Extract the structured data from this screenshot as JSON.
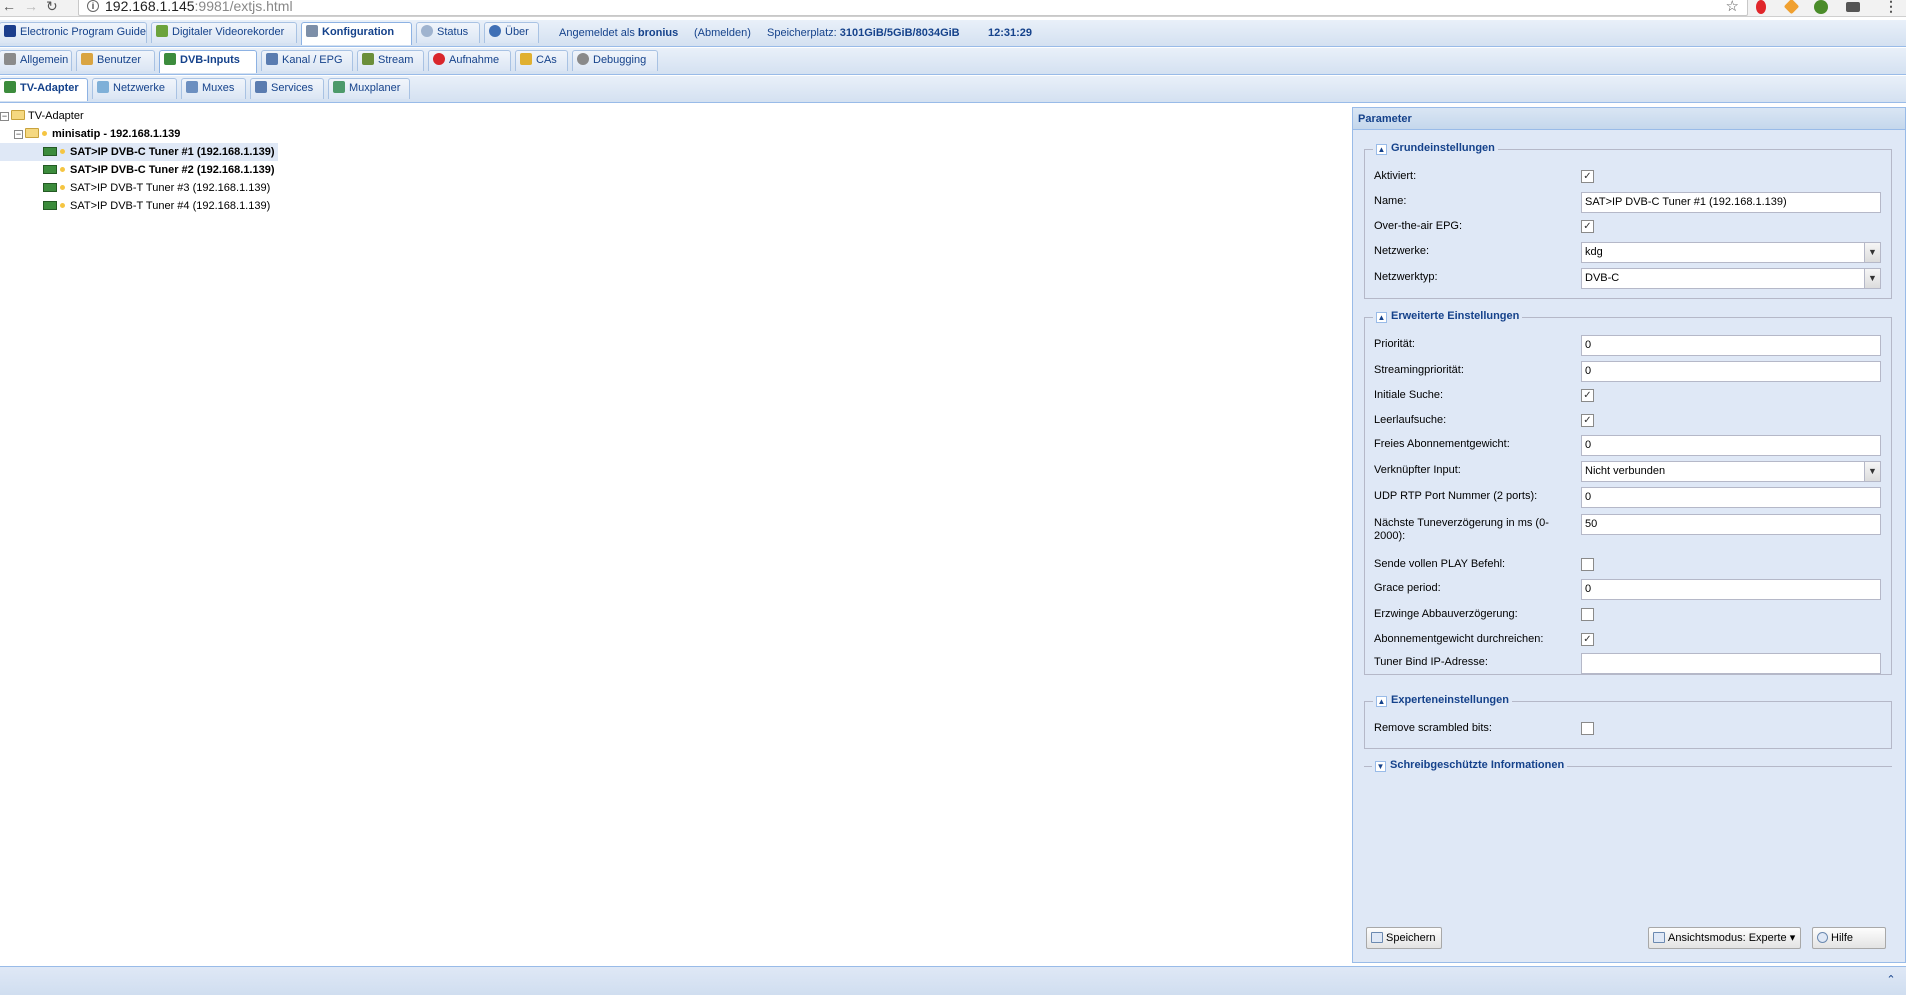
{
  "browser": {
    "url_host": "192.168.1.145",
    "url_rest": ":9981/extjs.html",
    "star_icon": "star-icon"
  },
  "top_tabs": [
    {
      "label": "Electronic Program Guide",
      "icon": "epg-icon",
      "active": false
    },
    {
      "label": "Digitaler Videorekorder",
      "icon": "dvr-icon",
      "active": false
    },
    {
      "label": "Konfiguration",
      "icon": "wrench-icon",
      "active": true
    },
    {
      "label": "Status",
      "icon": "eye-icon",
      "active": false
    },
    {
      "label": "Über",
      "icon": "info-icon",
      "active": false
    }
  ],
  "user_info": {
    "prefix": "Angemeldet als",
    "user": "bronius",
    "logout": "(Abmelden)",
    "storage_label": "Speicherplatz:",
    "storage_value": "3101GiB/5GiB/8034GiB",
    "time": "12:31:29"
  },
  "config_tabs": [
    {
      "label": "Allgemein",
      "active": false
    },
    {
      "label": "Benutzer",
      "active": false
    },
    {
      "label": "DVB-Inputs",
      "active": true
    },
    {
      "label": "Kanal / EPG",
      "active": false
    },
    {
      "label": "Stream",
      "active": false
    },
    {
      "label": "Aufnahme",
      "active": false
    },
    {
      "label": "CAs",
      "active": false
    },
    {
      "label": "Debugging",
      "active": false
    }
  ],
  "dvb_tabs": [
    {
      "label": "TV-Adapter",
      "active": true
    },
    {
      "label": "Netzwerke",
      "active": false
    },
    {
      "label": "Muxes",
      "active": false
    },
    {
      "label": "Services",
      "active": false
    },
    {
      "label": "Muxplaner",
      "active": false
    }
  ],
  "tree": {
    "root": "TV-Adapter",
    "device": "minisatip - 192.168.1.139",
    "tuners": [
      {
        "label": "SAT>IP DVB-C Tuner #1 (192.168.1.139)",
        "selected": true,
        "bold": true
      },
      {
        "label": "SAT>IP DVB-C Tuner #2 (192.168.1.139)",
        "selected": false,
        "bold": true
      },
      {
        "label": "SAT>IP DVB-T Tuner #3 (192.168.1.139)",
        "selected": false,
        "bold": false
      },
      {
        "label": "SAT>IP DVB-T Tuner #4 (192.168.1.139)",
        "selected": false,
        "bold": false
      }
    ]
  },
  "panel": {
    "title": "Parameter",
    "basic": {
      "legend": "Grundeinstellungen",
      "aktiviert": {
        "label": "Aktiviert:",
        "checked": true
      },
      "name": {
        "label": "Name:",
        "value": "SAT>IP DVB-C Tuner #1 (192.168.1.139)"
      },
      "epg": {
        "label": "Over-the-air EPG:",
        "checked": true
      },
      "netzwerke": {
        "label": "Netzwerke:",
        "value": "kdg"
      },
      "netzwerktyp": {
        "label": "Netzwerktyp:",
        "value": "DVB-C"
      }
    },
    "advanced": {
      "legend": "Erweiterte Einstellungen",
      "prioritaet": {
        "label": "Priorität:",
        "value": "0"
      },
      "streamprio": {
        "label": "Streamingpriorität:",
        "value": "0"
      },
      "initiale": {
        "label": "Initiale Suche:",
        "checked": true
      },
      "leerlauf": {
        "label": "Leerlaufsuche:",
        "checked": true
      },
      "abo": {
        "label": "Freies Abonnementgewicht:",
        "value": "0"
      },
      "verknuepft": {
        "label": "Verknüpfter Input:",
        "value": "Nicht verbunden"
      },
      "udp": {
        "label": "UDP RTP Port Nummer (2 ports):",
        "value": "0"
      },
      "tune_delay": {
        "label": "Nächste Tuneverzögerung in ms (0-2000):",
        "value": "50"
      },
      "play": {
        "label": "Sende vollen PLAY Befehl:",
        "checked": false
      },
      "grace": {
        "label": "Grace period:",
        "value": "0"
      },
      "abbau": {
        "label": "Erzwinge Abbauverzögerung:",
        "checked": false
      },
      "abo_durch": {
        "label": "Abonnementgewicht durchreichen:",
        "checked": true
      },
      "bind_ip": {
        "label": "Tuner Bind IP-Adresse:",
        "value": ""
      }
    },
    "expert": {
      "legend": "Experteneinstellungen",
      "scrambled": {
        "label": "Remove scrambled bits:",
        "checked": false
      }
    },
    "readonly": {
      "legend": "Schreibgeschützte Informationen"
    },
    "buttons": {
      "save": "Speichern",
      "view_mode": "Ansichtsmodus: Experte",
      "help": "Hilfe"
    }
  }
}
